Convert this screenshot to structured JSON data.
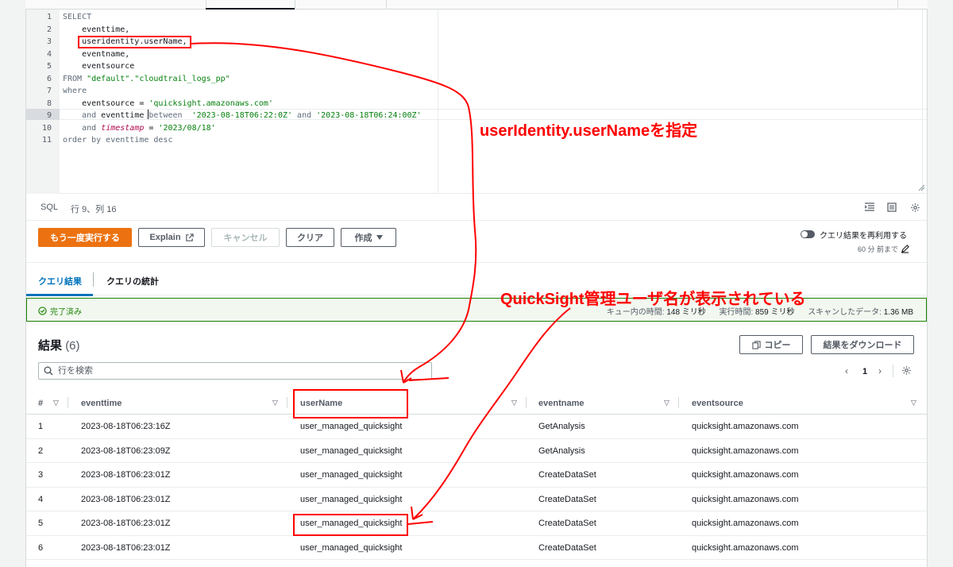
{
  "editor": {
    "lines": [
      {
        "n": "1"
      },
      {
        "n": "2"
      },
      {
        "n": "3"
      },
      {
        "n": "4"
      },
      {
        "n": "5"
      },
      {
        "n": "6"
      },
      {
        "n": "7"
      },
      {
        "n": "8"
      },
      {
        "n": "9"
      },
      {
        "n": "10"
      },
      {
        "n": "11"
      }
    ],
    "code": {
      "l1": "SELECT",
      "l2": "    eventtime,",
      "l3": "    useridentity.userName,",
      "l4": "    eventname,",
      "l5": "    eventsource",
      "l6_kw": "FROM ",
      "l6_str": "\"default\".\"cloudtrail_logs_pp\"",
      "l7": "where",
      "l8_a": "    eventsource = ",
      "l8_str": "'quicksight.amazonaws.com'",
      "l9_a": "    ",
      "l9_and": "and",
      "l9_b": " eventtime ",
      "l9_bt": "between",
      "l9_s1": "  '2023-08-18T06:22:0Z'",
      "l9_and2": " and ",
      "l9_s2": "'2023-08-18T06:24:00Z'",
      "l10_a": "    ",
      "l10_and": "and",
      "l10_sp": " ",
      "l10_fn": "timestamp",
      "l10_eq": " = ",
      "l10_str": "'2023/08/18'",
      "l11": "order by eventtime desc"
    }
  },
  "statusbar": {
    "language": "SQL",
    "position": "行 9、列 16"
  },
  "actions": {
    "run_again": "もう一度実行する",
    "explain": "Explain",
    "cancel": "キャンセル",
    "clear": "クリア",
    "create": "作成",
    "reuse_label": "クエリ結果を再利用する",
    "reuse_sub": "60 分 前まで"
  },
  "tabs": {
    "results": "クエリ結果",
    "stats": "クエリの統計"
  },
  "status": {
    "label": "完了済み",
    "queue_label": "キュー内の時間:",
    "queue_value": "148 ミリ秒",
    "exec_label": "実行時間:",
    "exec_value": "859 ミリ秒",
    "scan_label": "スキャンしたデータ:",
    "scan_value": "1.36 MB"
  },
  "results": {
    "title": "結果",
    "count": "(6)",
    "copy": "コピー",
    "download": "結果をダウンロード",
    "search_placeholder": "行を検索",
    "page": "1"
  },
  "table": {
    "columns": [
      "#",
      "eventtime",
      "userName",
      "eventname",
      "eventsource"
    ],
    "rows": [
      [
        "1",
        "2023-08-18T06:23:16Z",
        "user_managed_quicksight",
        "GetAnalysis",
        "quicksight.amazonaws.com"
      ],
      [
        "2",
        "2023-08-18T06:23:09Z",
        "user_managed_quicksight",
        "GetAnalysis",
        "quicksight.amazonaws.com"
      ],
      [
        "3",
        "2023-08-18T06:23:01Z",
        "user_managed_quicksight",
        "CreateDataSet",
        "quicksight.amazonaws.com"
      ],
      [
        "4",
        "2023-08-18T06:23:01Z",
        "user_managed_quicksight",
        "CreateDataSet",
        "quicksight.amazonaws.com"
      ],
      [
        "5",
        "2023-08-18T06:23:01Z",
        "user_managed_quicksight",
        "CreateDataSet",
        "quicksight.amazonaws.com"
      ],
      [
        "6",
        "2023-08-18T06:23:01Z",
        "user_managed_quicksight",
        "CreateDataSet",
        "quicksight.amazonaws.com"
      ]
    ]
  },
  "annotations": {
    "specify": "userIdentity.userNameを指定",
    "displayed": "QuickSight管理ユーザ名が表示されている"
  },
  "colors": {
    "primary_button": "#ec7211",
    "link_blue": "#0073bb",
    "success_green": "#1d8102",
    "annotation_red": "#ff0000"
  }
}
